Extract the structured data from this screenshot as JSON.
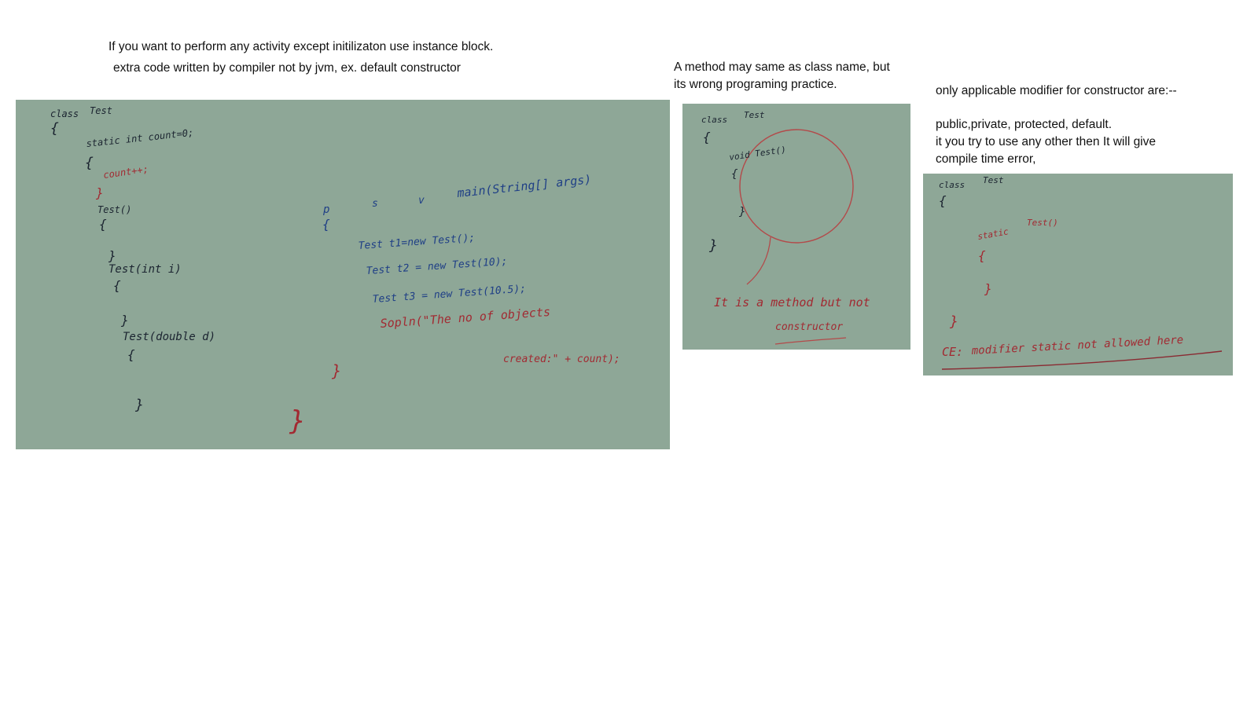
{
  "notes": {
    "instance_block": "If you want to perform any activity except initilizaton use instance block.",
    "default_constructor": "extra code written by compiler not by jvm, ex. default constructor",
    "method_name_line1": "A method may same as class name, but",
    "method_name_line2": "its wrong programing practice.",
    "modifiers_line1": "only applicable modifier for constructor are:--",
    "modifiers_line2": "public,private, protected, default.",
    "modifiers_line3": "it you try to use any other then It will give",
    "modifiers_line4": "compile time error,"
  },
  "board1": {
    "class_kw": "class",
    "class_name": "Test",
    "brace_open": "{",
    "static_line": "static int count=0;",
    "static_brace": "{",
    "count_inc": "count++;",
    "close1": "}",
    "ctor1": "Test()",
    "ctor1_open": "{",
    "close2": "}",
    "ctor2": "Test(int i)",
    "ctor2_open": "{",
    "close3": "}",
    "ctor3": "Test(double d)",
    "ctor3_open": "{",
    "close4": "}",
    "close_class": "}",
    "main_sig_p": "p",
    "main_sig_s": "s",
    "main_sig_v": "v",
    "main_sig": "main(String[] args)",
    "main_open": "{",
    "t1": "Test t1=new Test();",
    "t2": "Test t2 = new Test(10);",
    "t3": "Test t3 = new Test(10.5);",
    "sopln": "Sopln(\"The no of objects",
    "created": "created:\" + count);",
    "main_close": "}"
  },
  "board2": {
    "class_kw": "class",
    "class_name": "Test",
    "brace_open": "{",
    "method": "void Test()",
    "method_open": "{",
    "method_close": "}",
    "class_close": "}",
    "annotation_line1": "It is a method but not",
    "annotation_line2": "constructor"
  },
  "board3": {
    "class_kw": "class",
    "class_name": "Test",
    "brace_open": "{",
    "static_kw": "static",
    "ctor": "Test()",
    "ctor_open": "{",
    "ctor_close": "}",
    "class_close": "}",
    "ce_prefix": "CE:",
    "ce_message": "modifier static not allowed here"
  }
}
